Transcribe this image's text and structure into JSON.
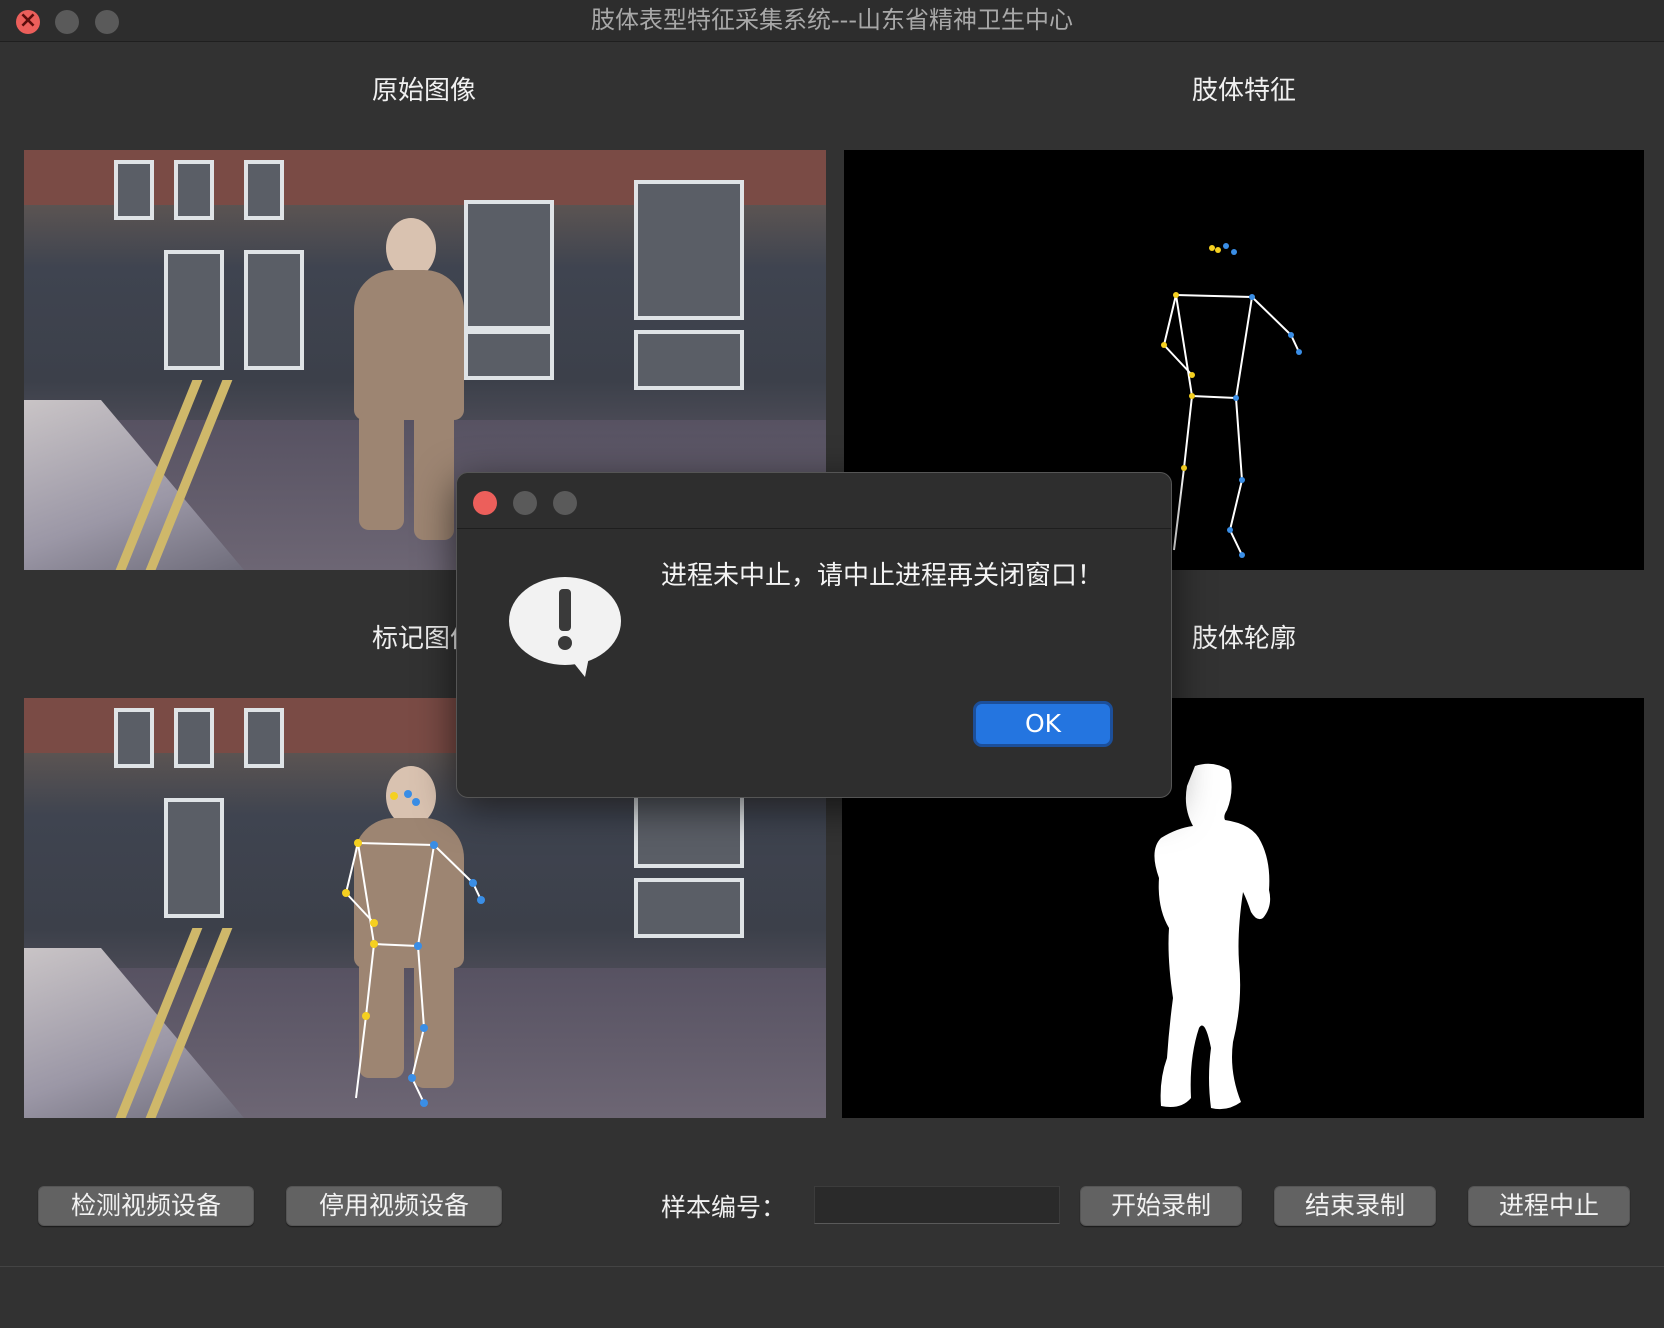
{
  "window": {
    "title": "肢体表型特征采集系统---山东省精神卫生中心"
  },
  "panels": {
    "original": {
      "label": "原始图像"
    },
    "limb_features": {
      "label": "肢体特征"
    },
    "marked": {
      "label": "标记图像"
    },
    "contour": {
      "label": "肢体轮廓"
    }
  },
  "toolbar": {
    "detect_label": "检测视频设备",
    "stop_device_label": "停用视频设备",
    "sample_label": "样本编号：",
    "sample_value": "",
    "start_label": "开始录制",
    "end_label": "结束录制",
    "abort_label": "进程中止"
  },
  "dialog": {
    "message": "进程未中止，请中止进程再关闭窗口！",
    "ok_label": "OK",
    "icon": "exclamation-bubble-icon"
  },
  "colors": {
    "background": "#323232",
    "accent": "#2475e0",
    "close_red": "#ec5f5b",
    "skeleton_line": "#ffffff",
    "joint_yellow": "#f5d020",
    "joint_blue": "#3a8ee6"
  }
}
